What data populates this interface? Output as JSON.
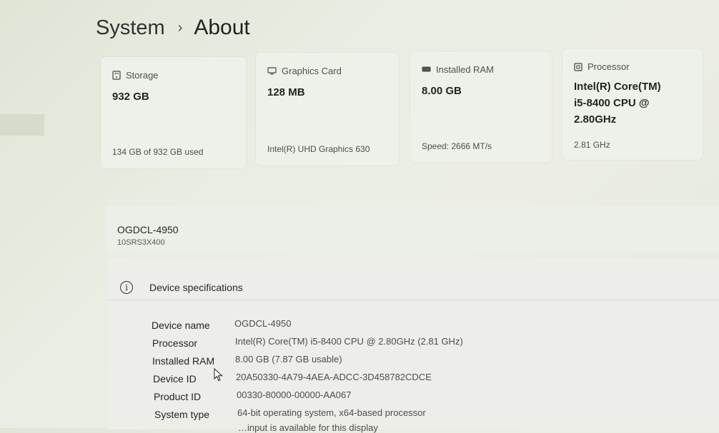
{
  "breadcrumb": {
    "parent": "System",
    "separator": "›",
    "current": "About"
  },
  "cards": {
    "storage": {
      "label": "Storage",
      "value": "932 GB",
      "detail": "134 GB of 932 GB used",
      "icon": "storage-icon"
    },
    "graphics": {
      "label": "Graphics Card",
      "value": "128 MB",
      "detail": "Intel(R) UHD Graphics 630",
      "icon": "graphics-card-icon"
    },
    "ram": {
      "label": "Installed RAM",
      "value": "8.00 GB",
      "detail": "Speed: 2666 MT/s",
      "icon": "ram-icon"
    },
    "processor": {
      "label": "Processor",
      "value_lines": [
        "Intel(R) Core(TM)",
        "i5-8400 CPU @",
        "2.80GHz"
      ],
      "detail": "2.81 GHz",
      "icon": "processor-icon"
    }
  },
  "device": {
    "name": "OGDCL-4950",
    "model": "10SRS3X400"
  },
  "specs": {
    "title": "Device specifications",
    "icon": "info-icon",
    "rows": [
      {
        "label": "Device name",
        "value": "OGDCL-4950"
      },
      {
        "label": "Processor",
        "value": "Intel(R) Core(TM) i5-8400 CPU @ 2.80GHz (2.81 GHz)"
      },
      {
        "label": "Installed RAM",
        "value": "8.00 GB (7.87 GB usable)"
      },
      {
        "label": "Device ID",
        "value": "20A50330-4A79-4AEA-ADCC-3D458782CDCE"
      },
      {
        "label": "Product ID",
        "value": "00330-80000-00000-AA067"
      },
      {
        "label": "System type",
        "value": "64-bit operating system, x64-based processor"
      },
      {
        "label": "",
        "value": "…input is available for this display"
      }
    ]
  }
}
